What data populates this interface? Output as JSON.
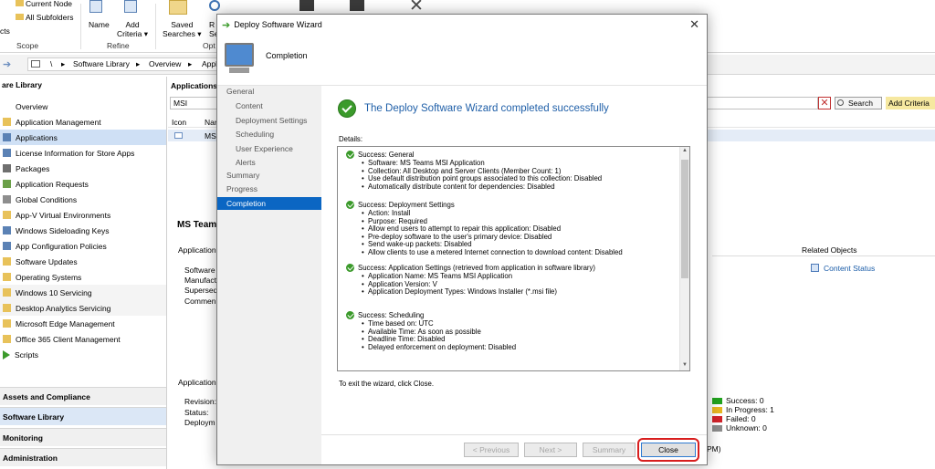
{
  "ribbon": {
    "current_node": "Current Node",
    "all_subfolders": "All Subfolders",
    "objects_partial": "cts",
    "scope": "Scope",
    "name": "Name",
    "add_criteria_1": "Add",
    "add_criteria_2": "Criteria",
    "refine": "Refine",
    "saved_searches_1": "Saved",
    "saved_searches_2": "Searches",
    "re_1": "R",
    "re_2": "Sea",
    "options_partial": "Opt"
  },
  "address": {
    "sep": "\\",
    "crumbs": [
      "Software Library",
      "Overview",
      "Appl"
    ]
  },
  "nav": {
    "header": "are Library",
    "items": [
      "Overview",
      "Application Management",
      "Applications",
      "License Information for Store Apps",
      "Packages",
      "Application Requests",
      "Global Conditions",
      "App-V Virtual Environments",
      "Windows Sideloading Keys",
      "App Configuration Policies",
      "Software Updates",
      "Operating Systems",
      "Windows 10 Servicing",
      "Desktop Analytics Servicing",
      "Microsoft Edge Management",
      "Office 365 Client Management",
      "Scripts"
    ],
    "sections": [
      "Assets and Compliance",
      "Software Library",
      "Monitoring",
      "Administration"
    ]
  },
  "main": {
    "list_title": "Applications",
    "search_value": "MSI",
    "search_button": "Search",
    "add_criteria": "Add Criteria",
    "col_icon": "Icon",
    "col_name": "Nar",
    "row_name": "MS",
    "detail_title": "MS Teams",
    "detail_section": "Application",
    "detail_labels": [
      "Software",
      "Manufact",
      "Supersed",
      "Commen"
    ],
    "related_objects": "Related Objects",
    "content_status": "Content Status",
    "deploy_section": "Application",
    "deploy_labels": [
      "Revision:",
      "Status:",
      "Deploym"
    ],
    "legend": [
      "Success: 0",
      "In Progress: 1",
      "Failed: 0",
      "Unknown: 0"
    ],
    "pm_text": "PM)",
    "colors": {
      "success": "#22a31f",
      "in_progress": "#e8b722",
      "failed": "#d1232a",
      "unknown": "#8c8c8c"
    }
  },
  "dialog": {
    "title": "Deploy Software Wizard",
    "header": "Completion",
    "steps": [
      "General",
      "Content",
      "Deployment Settings",
      "Scheduling",
      "User Experience",
      "Alerts",
      "Summary",
      "Progress",
      "Completion"
    ],
    "success_title": "The Deploy Software Wizard completed successfully",
    "details_label": "Details:",
    "details": [
      {
        "head": "Success: General",
        "lines": [
          "Software: MS Teams MSI Application",
          "Collection: All Desktop and Server Clients (Member Count: 1)",
          "Use default distribution point groups associated to this collection: Disabled",
          "Automatically distribute content for dependencies: Disabled"
        ]
      },
      {
        "head": "Success: Deployment Settings",
        "lines": [
          "Action: Install",
          "Purpose: Required",
          "Allow end users to attempt to repair this application: Disabled",
          "Pre-deploy software to the user's primary device: Disabled",
          "Send wake-up packets: Disabled",
          "Allow clients to use a metered Internet connection to download content: Disabled"
        ]
      },
      {
        "head": "Success: Application Settings (retrieved from application in software library)",
        "lines": [
          "Application Name: MS Teams MSI Application",
          "Application Version: V",
          "Application Deployment Types: Windows Installer (*.msi file)"
        ]
      },
      {
        "head": "Success: Scheduling",
        "lines": [
          "Time based on: UTC",
          "Available Time: As soon as possible",
          "Deadline Time: Disabled",
          "Delayed enforcement on deployment: Disabled"
        ]
      }
    ],
    "exit_text": "To exit the wizard, click Close.",
    "buttons": {
      "previous": "< Previous",
      "next": "Next >",
      "summary": "Summary",
      "close": "Close"
    }
  }
}
